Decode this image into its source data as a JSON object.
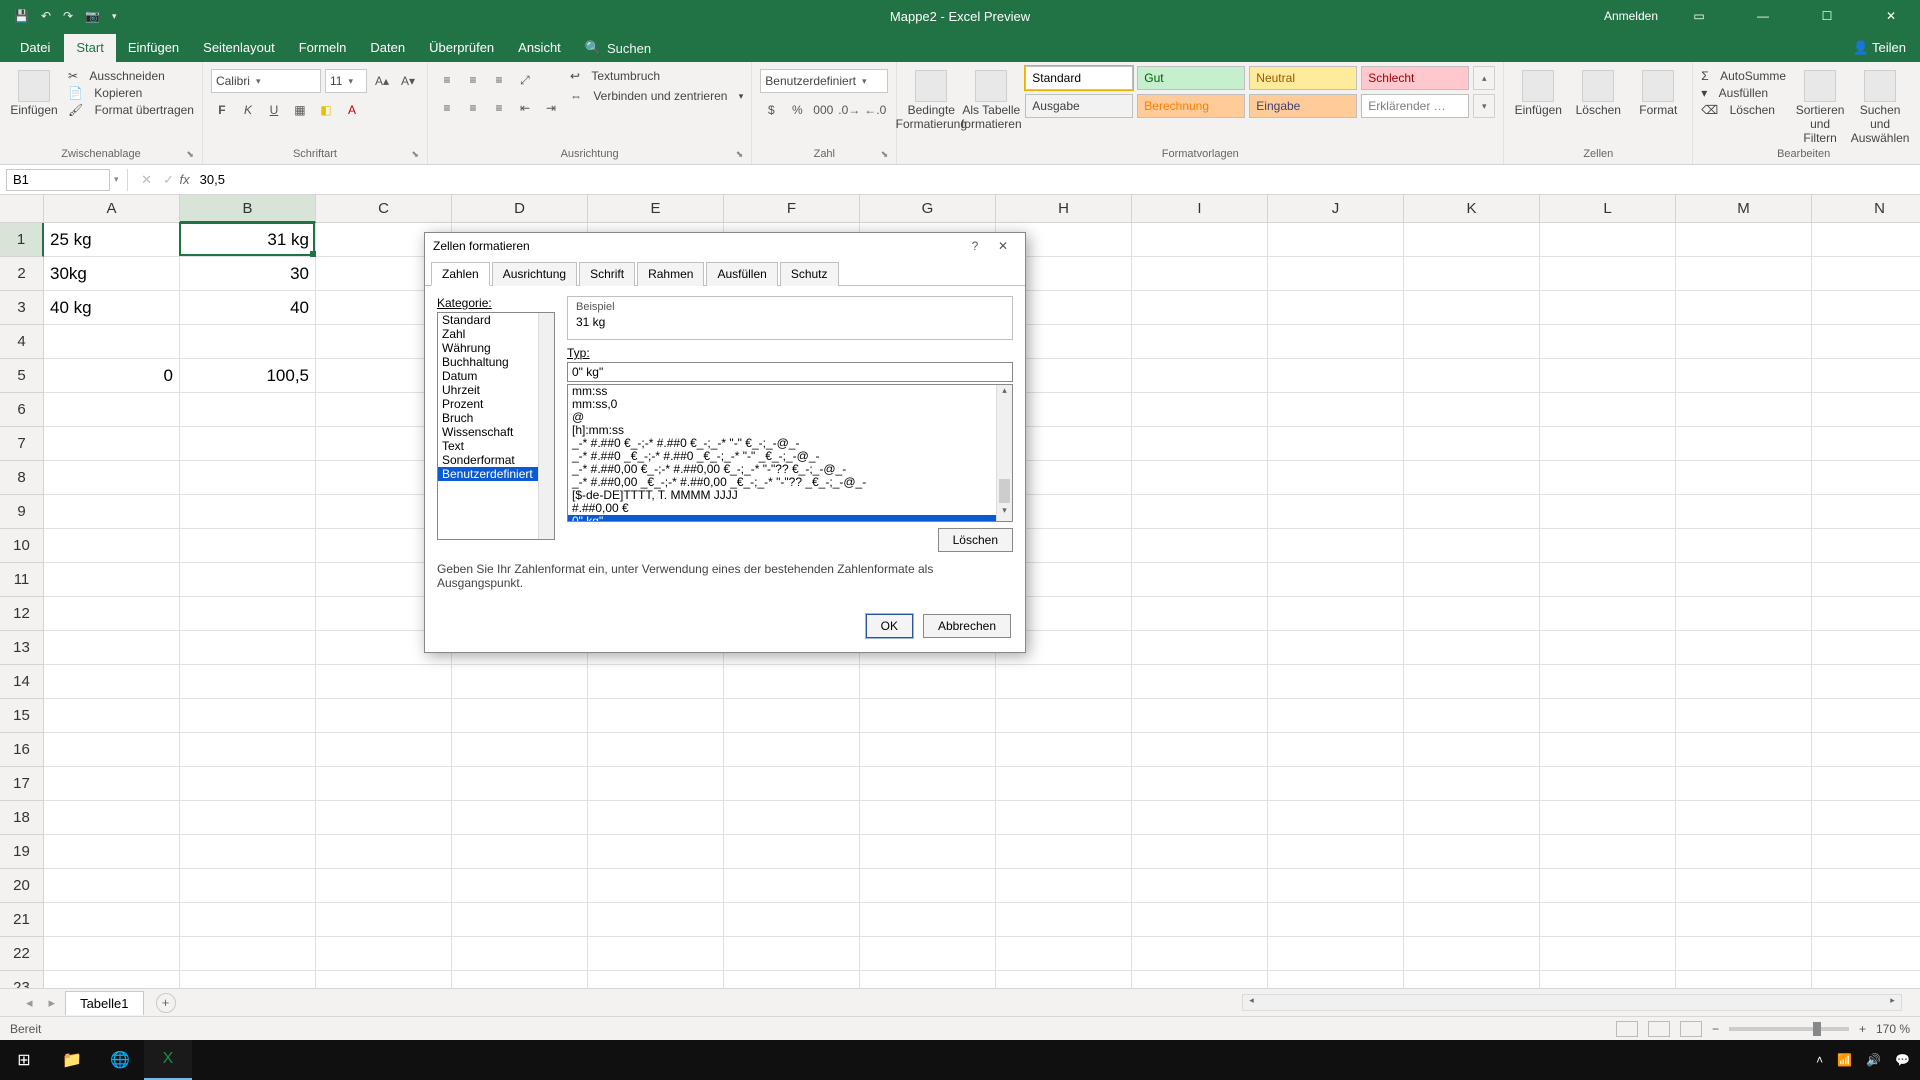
{
  "titlebar": {
    "title": "Mappe2 - Excel Preview",
    "signin": "Anmelden"
  },
  "tabs": {
    "file": "Datei",
    "items": [
      "Start",
      "Einfügen",
      "Seitenlayout",
      "Formeln",
      "Daten",
      "Überprüfen",
      "Ansicht"
    ],
    "active": 0,
    "search": "Suchen",
    "share": "Teilen"
  },
  "ribbon": {
    "clipboard": {
      "paste": "Einfügen",
      "cut": "Ausschneiden",
      "copy": "Kopieren",
      "formatpainter": "Format übertragen",
      "label": "Zwischenablage"
    },
    "font": {
      "name": "Calibri",
      "size": "11",
      "label": "Schriftart"
    },
    "align": {
      "wrap": "Textumbruch",
      "merge": "Verbinden und zentrieren",
      "label": "Ausrichtung"
    },
    "number": {
      "format": "Benutzerdefiniert",
      "label": "Zahl"
    },
    "styles": {
      "cond": "Bedingte Formatierung",
      "table": "Als Tabelle formatieren",
      "cells": [
        {
          "t": "Standard",
          "bg": "#ffffff",
          "fg": "#000"
        },
        {
          "t": "Gut",
          "bg": "#c6efce",
          "fg": "#006100"
        },
        {
          "t": "Neutral",
          "bg": "#ffeb9c",
          "fg": "#9c5700"
        },
        {
          "t": "Schlecht",
          "bg": "#ffc7ce",
          "fg": "#9c0006"
        },
        {
          "t": "Ausgabe",
          "bg": "#f2f2f2",
          "fg": "#3f3f3f"
        },
        {
          "t": "Berechnung",
          "bg": "#ffcc99",
          "fg": "#fa7d00"
        },
        {
          "t": "Eingabe",
          "bg": "#ffcc99",
          "fg": "#3f3f76"
        },
        {
          "t": "Erklärender …",
          "bg": "#ffffff",
          "fg": "#7f7f7f"
        }
      ],
      "label": "Formatvorlagen"
    },
    "cells": {
      "insert": "Einfügen",
      "delete": "Löschen",
      "format": "Format",
      "label": "Zellen"
    },
    "editing": {
      "autosum": "AutoSumme",
      "fill": "Ausfüllen",
      "clear": "Löschen",
      "sort": "Sortieren und Filtern",
      "find": "Suchen und Auswählen",
      "label": "Bearbeiten"
    }
  },
  "fbar": {
    "name": "B1",
    "value": "30,5"
  },
  "grid": {
    "cols": [
      "A",
      "B",
      "C",
      "D",
      "E",
      "F",
      "G",
      "H",
      "I",
      "J",
      "K",
      "L",
      "M",
      "N"
    ],
    "rows": 23,
    "selCol": 1,
    "selRow": 0,
    "data": {
      "A1": "25 kg",
      "B1": "31 kg",
      "A2": "30kg",
      "B2": "30",
      "A3": "40 kg",
      "B3": "40",
      "A5": "0",
      "B5": "100,5"
    },
    "rightAlign": [
      "B1",
      "B2",
      "B3",
      "A5",
      "B5"
    ]
  },
  "sheet": {
    "name": "Tabelle1"
  },
  "status": {
    "ready": "Bereit",
    "zoom": "170 %"
  },
  "dialog": {
    "title": "Zellen formatieren",
    "tabs": [
      "Zahlen",
      "Ausrichtung",
      "Schrift",
      "Rahmen",
      "Ausfüllen",
      "Schutz"
    ],
    "activeTab": 0,
    "categoryLabel": "Kategorie:",
    "categories": [
      "Standard",
      "Zahl",
      "Währung",
      "Buchhaltung",
      "Datum",
      "Uhrzeit",
      "Prozent",
      "Bruch",
      "Wissenschaft",
      "Text",
      "Sonderformat",
      "Benutzerdefiniert"
    ],
    "categorySel": 11,
    "sampleLabel": "Beispiel",
    "sampleValue": "31 kg",
    "typeLabel": "Typ:",
    "typeValue": "0\" kg\"",
    "formats": [
      "mm:ss",
      "mm:ss,0",
      "@",
      "[h]:mm:ss",
      "_-* #.##0 €_-;-* #.##0 €_-;_-* \"-\" €_-;_-@_-",
      "_-* #.##0 _€_-;-* #.##0 _€_-;_-* \"-\" _€_-;_-@_-",
      "_-* #.##0,00 €_-;-* #.##0,00 €_-;_-* \"-\"?? €_-;_-@_-",
      "_-* #.##0,00 _€_-;-* #.##0,00 _€_-;_-* \"-\"?? _€_-;_-@_-",
      "[$-de-DE]TTTT, T. MMMM JJJJ",
      "#.##0,00 €",
      "0\" kg\""
    ],
    "formatSel": 10,
    "delete": "Löschen",
    "hint": "Geben Sie Ihr Zahlenformat ein, unter Verwendung eines der bestehenden Zahlenformate als Ausgangspunkt.",
    "ok": "OK",
    "cancel": "Abbrechen"
  },
  "taskbar": {
    "time": "",
    "date": ""
  }
}
